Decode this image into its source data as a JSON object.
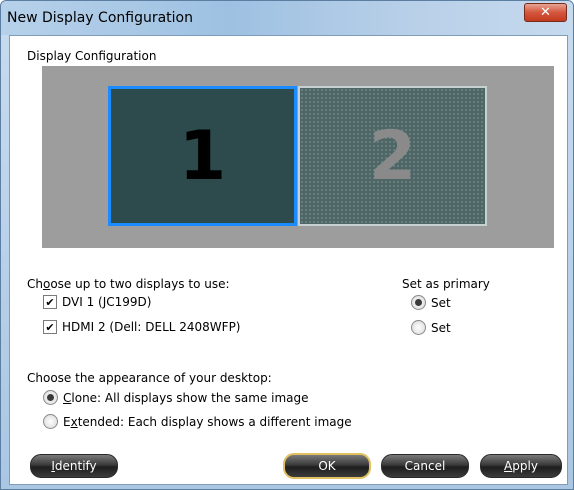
{
  "window": {
    "title": "New Display Configuration",
    "close_glyph": "✕"
  },
  "display_config": {
    "label": "Display Configuration",
    "monitors": [
      {
        "number": "1",
        "selected": true
      },
      {
        "number": "2",
        "selected": false
      }
    ]
  },
  "choose_displays": {
    "label_prefix": "Ch",
    "label_hotkey": "o",
    "label_suffix": "ose up to two displays to use:",
    "items": [
      {
        "label": "DVI 1 (JC199D)",
        "checked": true
      },
      {
        "label": "HDMI 2 (Dell: DELL 2408WFP)",
        "checked": true
      }
    ]
  },
  "primary": {
    "label": "Set as primary",
    "options": [
      {
        "label": "Set",
        "selected": true
      },
      {
        "label": "Set",
        "selected": false
      }
    ]
  },
  "appearance": {
    "label": "Choose the appearance of your desktop:",
    "options": [
      {
        "hotkey": "C",
        "rest": "lone: All displays show the same image",
        "selected": true
      },
      {
        "prefix": "E",
        "hotkey": "x",
        "rest": "tended: Each display shows a different image",
        "selected": false
      }
    ]
  },
  "buttons": {
    "identify_hotkey": "I",
    "identify_rest": "dentify",
    "ok": "OK",
    "cancel": "Cancel",
    "apply_hotkey": "A",
    "apply_rest": "pply"
  },
  "icons": {
    "close": "close-icon",
    "check": "checkmark-icon"
  },
  "colors": {
    "selected_border": "#1a8cff",
    "monitor1_bg": "#2d4a4c",
    "preview_bg": "#9d9d9d"
  }
}
